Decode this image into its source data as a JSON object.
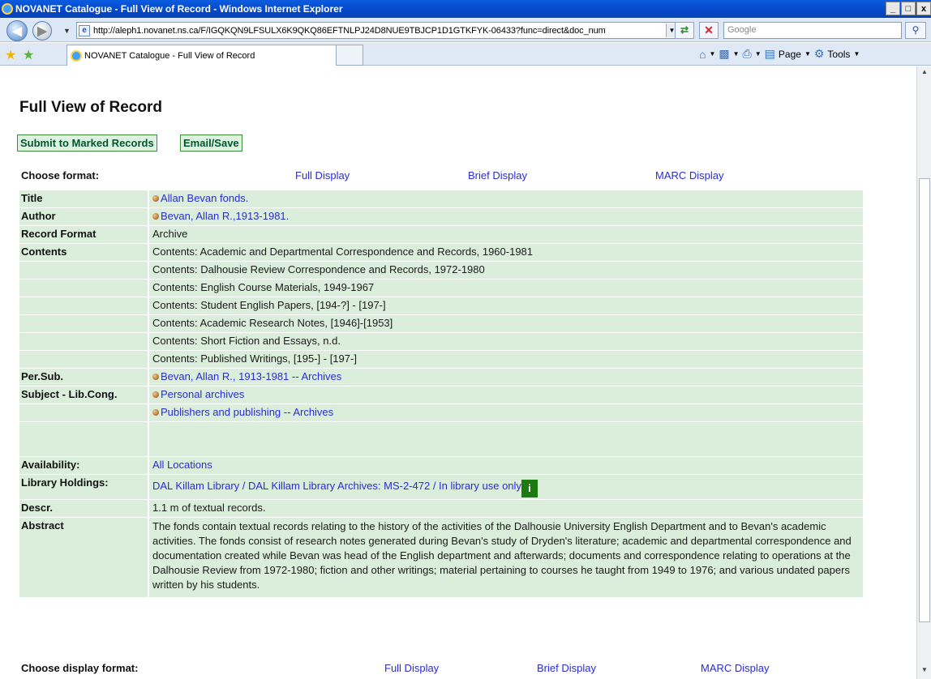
{
  "window": {
    "title": "NOVANET Catalogue - Full View of Record - Windows Internet Explorer",
    "buttons": [
      "_",
      "□",
      "x"
    ]
  },
  "address_bar": {
    "url": "http://aleph1.novanet.ns.ca/F/IGQKQN9LFSULX6K9QKQ86EFTNLPJ24D8NUE9TBJCP1D1GTKFYK-06433?func=direct&doc_num",
    "search_placeholder": "Google"
  },
  "tab": {
    "label": "NOVANET Catalogue - Full View of Record"
  },
  "commands": {
    "page": "Page",
    "tools": "Tools"
  },
  "page": {
    "title": "Full View of Record",
    "actions": {
      "submit": "Submit to Marked Records",
      "email": "Email/Save"
    },
    "format_top": {
      "label": "Choose format:",
      "full": "Full Display",
      "brief": "Brief Display",
      "marc": "MARC Display"
    },
    "format_bottom": {
      "label": "Choose display format:",
      "full": "Full Display",
      "brief": "Brief Display",
      "marc": "MARC Display"
    },
    "record": [
      {
        "label": "Title",
        "value": "Allan Bevan fonds.",
        "link": true,
        "bullet": true
      },
      {
        "label": "Author",
        "value": "Bevan, Allan R.,1913-1981.",
        "link": true,
        "bullet": true
      },
      {
        "label": "Record Format",
        "value": "Archive",
        "link": false,
        "bullet": false
      },
      {
        "label": "Contents",
        "value": "Contents: Academic and Departmental Correspondence and Records, 1960-1981",
        "link": false,
        "bullet": false
      },
      {
        "label": "",
        "value": "Contents: Dalhousie Review Correspondence and Records, 1972-1980",
        "link": false,
        "bullet": false
      },
      {
        "label": "",
        "value": "Contents: English Course Materials, 1949-1967",
        "link": false,
        "bullet": false
      },
      {
        "label": "",
        "value": "Contents: Student English Papers, [194-?] - [197-]",
        "link": false,
        "bullet": false
      },
      {
        "label": "",
        "value": "Contents: Academic Research Notes, [1946]-[1953]",
        "link": false,
        "bullet": false
      },
      {
        "label": "",
        "value": "Contents: Short Fiction and Essays, n.d.",
        "link": false,
        "bullet": false
      },
      {
        "label": "",
        "value": "Contents: Published Writings, [195-] - [197-]",
        "link": false,
        "bullet": false
      },
      {
        "label": "Per.Sub.",
        "value": "Bevan, Allan R., 1913-1981 -- Archives",
        "link": true,
        "bullet": true
      },
      {
        "label": "Subject - Lib.Cong.",
        "value": "Personal archives",
        "link": true,
        "bullet": true
      },
      {
        "label": "",
        "value": "Publishers and publishing -- Archives",
        "link": true,
        "bullet": true
      },
      {
        "label": "",
        "value": "",
        "link": false,
        "bullet": false
      },
      {
        "label": "Availability:",
        "value": "All Locations",
        "link": true,
        "bullet": false
      },
      {
        "label": "Library Holdings:",
        "value": "DAL Killam Library / DAL Killam Library Archives: MS-2-472 / In library use only",
        "link": true,
        "bullet": false,
        "info": "i"
      },
      {
        "label": "Descr.",
        "value": "1.1 m of textual records.",
        "link": false,
        "bullet": false
      },
      {
        "label": "Abstract",
        "value": "The fonds contain textual records relating to the history of the activities of the Dalhousie University English Department and to Bevan's academic activities. The fonds consist of research notes generated during Bevan's study of Dryden's literature; academic and departmental correspondence and documentation created while Bevan was head of the English department and afterwards; documents and correspondence relating to operations at the Dalhousie Review from 1972-1980; fiction and other writings; material pertaining to courses he taught from 1949 to 1976; and various undated papers written by his students.",
        "link": false,
        "bullet": false
      }
    ]
  }
}
